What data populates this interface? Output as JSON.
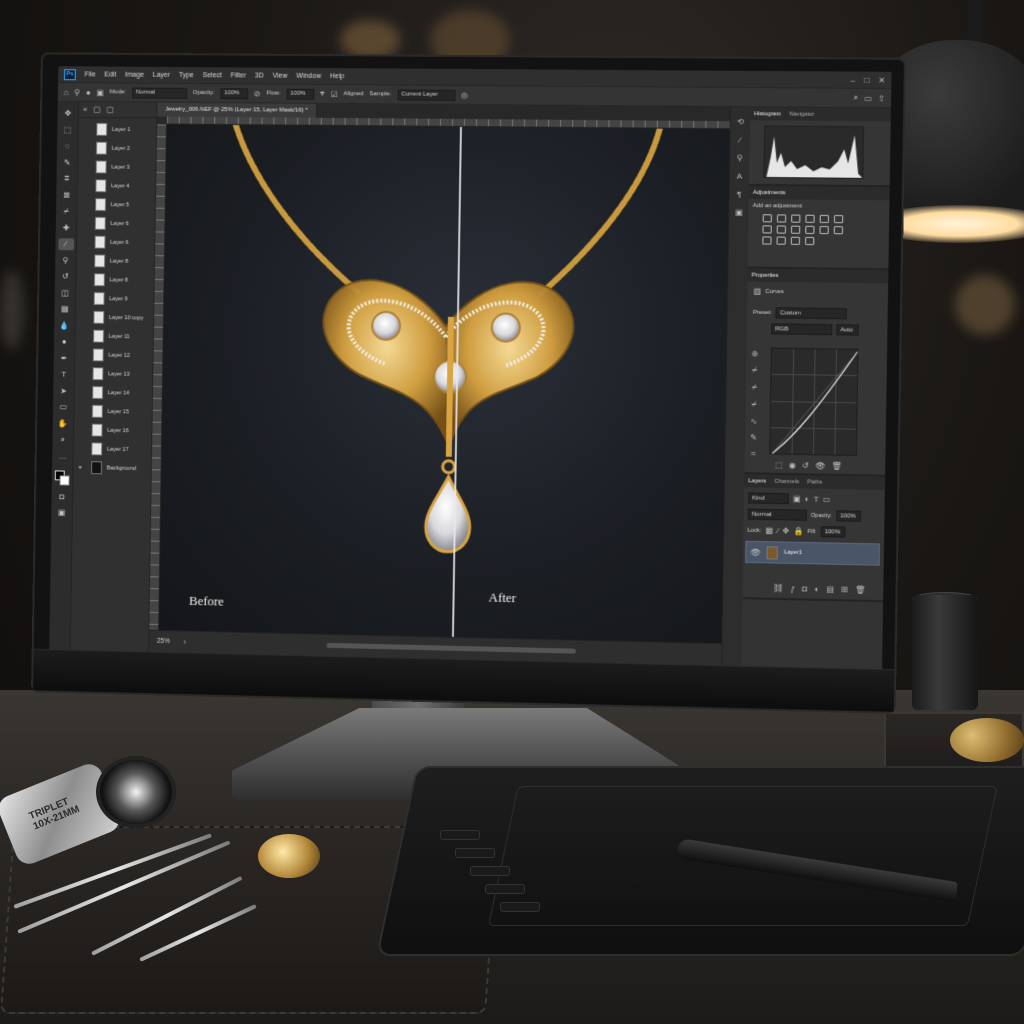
{
  "app": {
    "logo": "Ps",
    "menu": [
      "File",
      "Edit",
      "Image",
      "Layer",
      "Type",
      "Select",
      "Filter",
      "3D",
      "View",
      "Window",
      "Help"
    ]
  },
  "options_bar": {
    "mode_label": "Mode:",
    "mode_value": "Normal",
    "opacity_label": "Opacity:",
    "opacity_value": "100%",
    "flow_label": "Flow:",
    "flow_value": "100%",
    "aligned_label": "Aligned",
    "sample_label": "Sample:",
    "sample_value": "Current Layer"
  },
  "document": {
    "tab_title": "Jewelry_006.NEF @ 25% (Layer 15, Layer Mask/16) *",
    "before_label": "Before",
    "after_label": "After",
    "zoom": "25%"
  },
  "left_layers": {
    "items": [
      "Layer 1",
      "Layer 2",
      "Layer 3",
      "Layer 4",
      "Layer 5",
      "Layer 6",
      "Layer 6",
      "Layer 8",
      "Layer 8",
      "Layer 9",
      "Layer 10 copy",
      "Layer 11",
      "Layer 12",
      "Layer 13",
      "Layer 14",
      "Layer 15",
      "Layer 16",
      "Layer 17",
      "Background"
    ]
  },
  "histogram": {
    "tabs": [
      "Histogram",
      "Navigator"
    ]
  },
  "adjustments": {
    "title": "Adjustments",
    "add_label": "Add an adjustment"
  },
  "properties": {
    "title": "Properties",
    "panel_name": "Curves",
    "preset_label": "Preset:",
    "preset_value": "Custom",
    "channel_value": "RGB",
    "auto_label": "Auto"
  },
  "layers_panel": {
    "tabs": [
      "Layers",
      "Channels",
      "Paths"
    ],
    "kind_value": "Kind",
    "blend_value": "Normal",
    "opacity_label": "Opacity:",
    "opacity_value": "100%",
    "lock_label": "Lock:",
    "fill_label": "Fill:",
    "fill_value": "100%",
    "selected_layer": "Layer1"
  },
  "scene": {
    "loupe_text_1": "TRIPLET",
    "loupe_text_2": "10X-21MM"
  },
  "colors": {
    "ps_blue": "#31a8ff",
    "gold": "#d9a441",
    "canvas_bg": "#1d2026",
    "ui_dark": "#3c3c3c"
  }
}
